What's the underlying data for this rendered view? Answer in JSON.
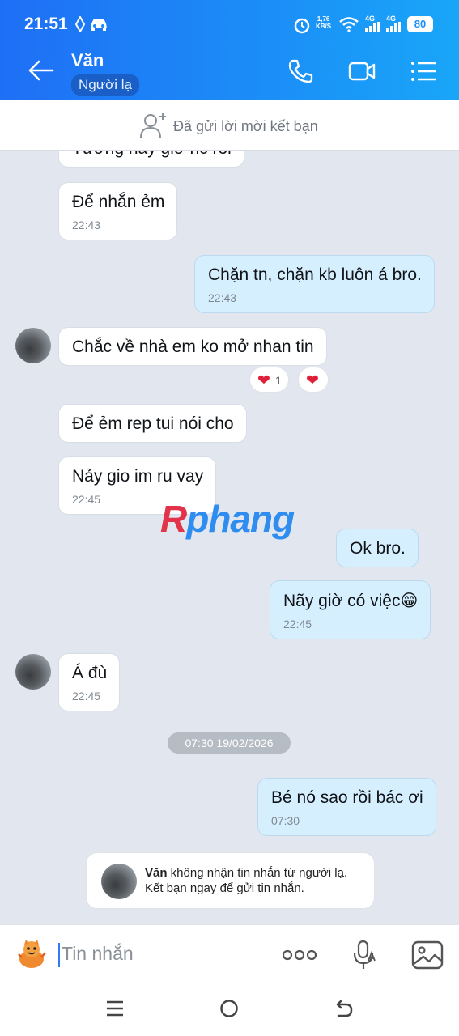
{
  "status_bar": {
    "time": "21:51",
    "network_speed": "1,76\nKB/S",
    "sim1": "4G",
    "sim2": "4G",
    "battery": "80"
  },
  "header": {
    "contact_name": "Văn",
    "badge": "Người lạ",
    "icons": [
      "back-arrow-icon",
      "phone-icon",
      "video-call-icon",
      "menu-list-icon"
    ]
  },
  "friend_request": {
    "text": "Đã gửi lời mời kết bạn",
    "icon": "add-friend-icon"
  },
  "messages": [
    {
      "side": "in",
      "text": "Tưởng nãy giờ nc rồi",
      "time": ""
    },
    {
      "side": "in",
      "text": "Để nhắn ẻm",
      "time": "22:43"
    },
    {
      "side": "out",
      "text": "Chặn tn, chặn kb luôn á bro.",
      "time": "22:43"
    },
    {
      "side": "in",
      "text": "Chắc về nhà em ko mở nhan tin",
      "time": "",
      "reaction_count": "1"
    },
    {
      "side": "in",
      "text": "Để ẻm rep tui nói cho",
      "time": ""
    },
    {
      "side": "in",
      "text": "Nảy gio im ru vay",
      "time": "22:45"
    },
    {
      "side": "out",
      "text": "Ok bro.",
      "time": ""
    },
    {
      "side": "out",
      "text": "Nãy giờ có việc",
      "emoji": "😁",
      "time": "22:45"
    },
    {
      "side": "in",
      "text": "Á đù",
      "time": "22:45"
    },
    {
      "side": "out",
      "text": "Bé nó sao rồi bác ơi",
      "time": "07:30"
    }
  ],
  "date_separator": "07:30 19/02/2026",
  "watermark": {
    "r": "R",
    "rest": "phang"
  },
  "notice": {
    "name": "Văn",
    "line1": " không nhận tin nhắn từ người lạ.",
    "line2": "Kết bạn ngay để gửi tin nhắn."
  },
  "composer": {
    "placeholder": "Tin nhắn",
    "icons": [
      "sticker-icon",
      "more-icon",
      "voice-icon",
      "image-icon"
    ]
  },
  "navbar": {
    "icons": [
      "recent-apps-icon",
      "home-icon",
      "back-icon"
    ]
  },
  "colors": {
    "header_blue": "#1b8ff7",
    "outgoing_bubble": "#d6efff",
    "chat_bg": "#e2e7ef",
    "heart": "#e01e37"
  }
}
